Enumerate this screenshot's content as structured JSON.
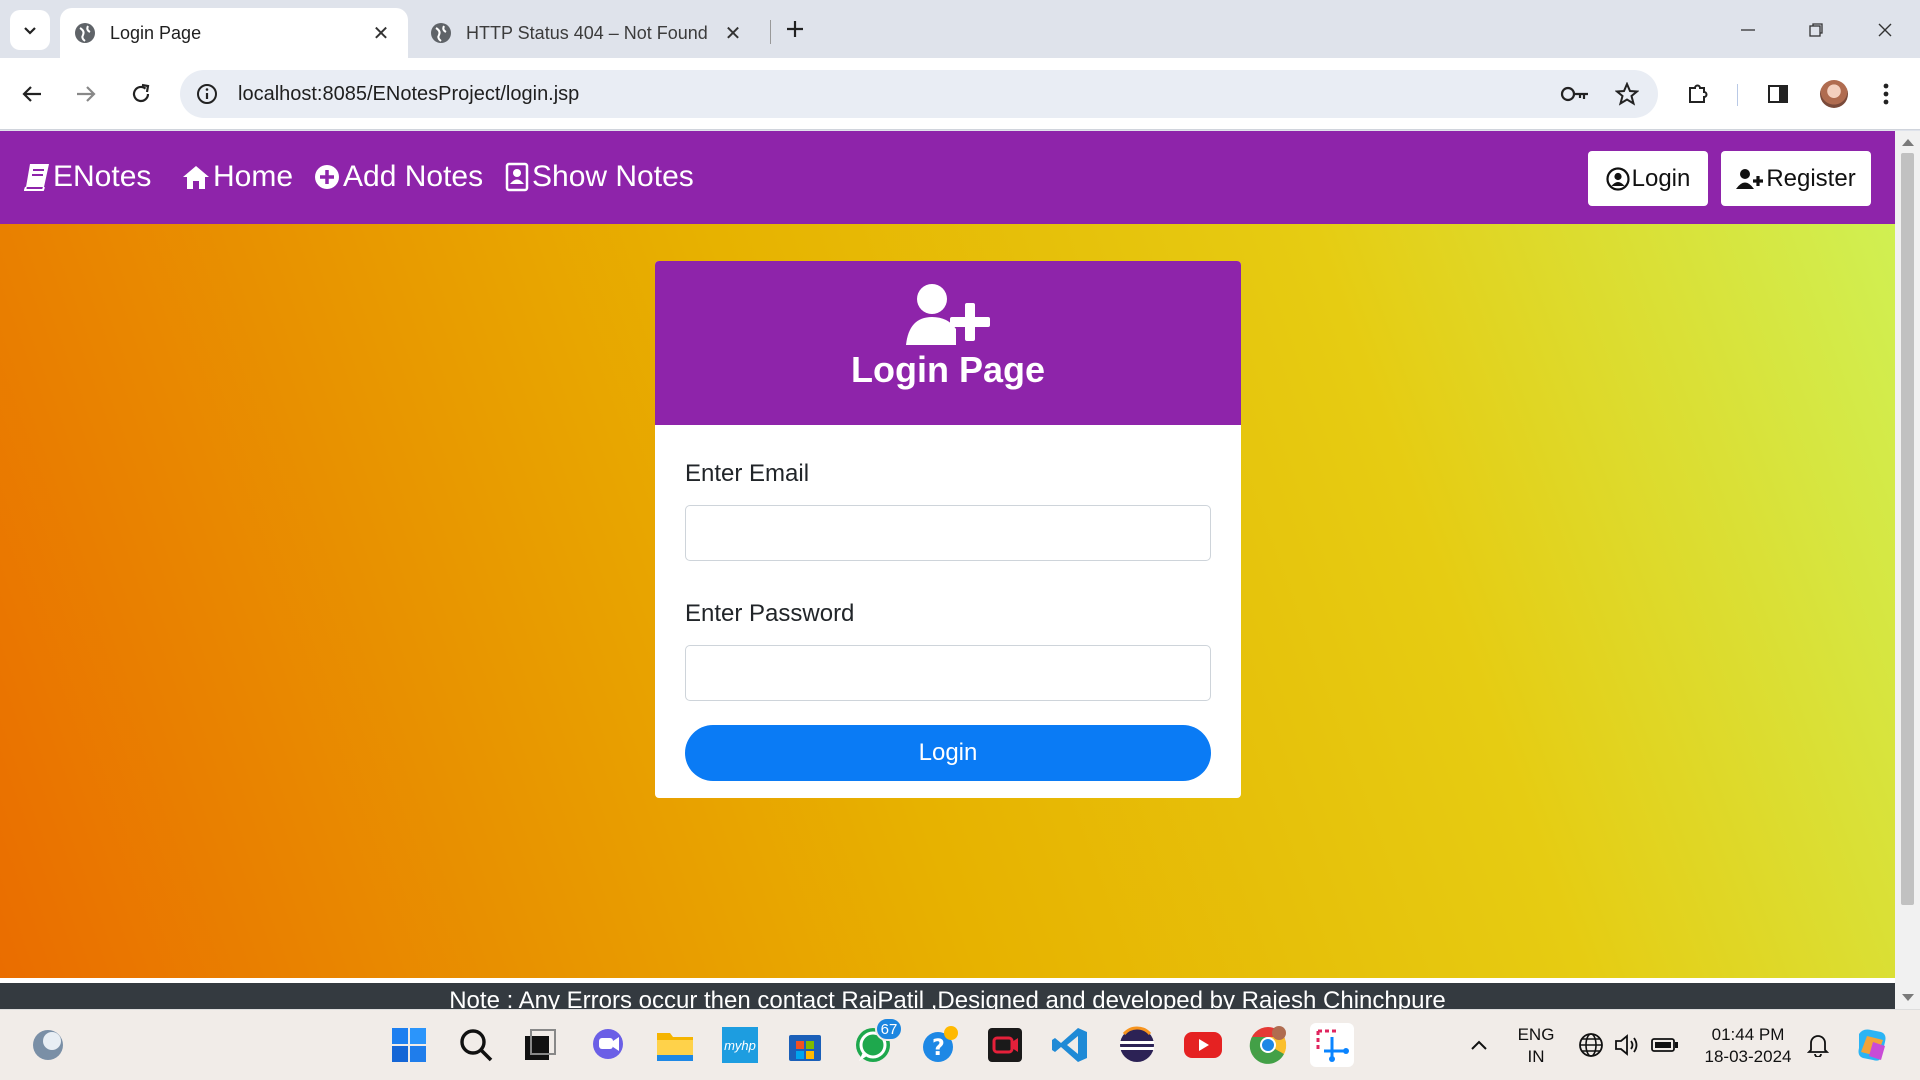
{
  "browser": {
    "tabs": [
      {
        "title": "Login Page",
        "active": true
      },
      {
        "title": "HTTP Status 404 – Not Found",
        "active": false
      }
    ],
    "url": "localhost:8085/ENotesProject/login.jsp"
  },
  "navbar": {
    "brand": "ENotes",
    "links": [
      "Home",
      "Add Notes",
      "Show Notes"
    ],
    "login_label": "Login",
    "register_label": "Register",
    "color": "#8e24aa"
  },
  "login_card": {
    "title": "Login Page",
    "email_label": "Enter Email",
    "email_value": "",
    "password_label": "Enter Password",
    "password_value": "",
    "submit_label": "Login",
    "submit_color": "#0a7bf5"
  },
  "footer": {
    "text": "Note : Any Errors occur then contact RajPatil ,Designed and developed by Rajesh Chinchpure"
  },
  "taskbar": {
    "apps": [
      "start-icon",
      "search-icon",
      "task-view-icon",
      "chat-icon",
      "file-explorer-icon",
      "myhp-icon",
      "store-icon",
      "whatsapp-icon",
      "help-icon",
      "screen-recorder-icon",
      "vscode-icon",
      "eclipse-icon",
      "youtube-icon",
      "chrome-icon",
      "snipping-tool-icon"
    ],
    "whatsapp_badge": "67",
    "myhp_label": "myhp",
    "language": "ENG",
    "region": "IN",
    "time": "01:44 PM",
    "date": "18-03-2024"
  }
}
